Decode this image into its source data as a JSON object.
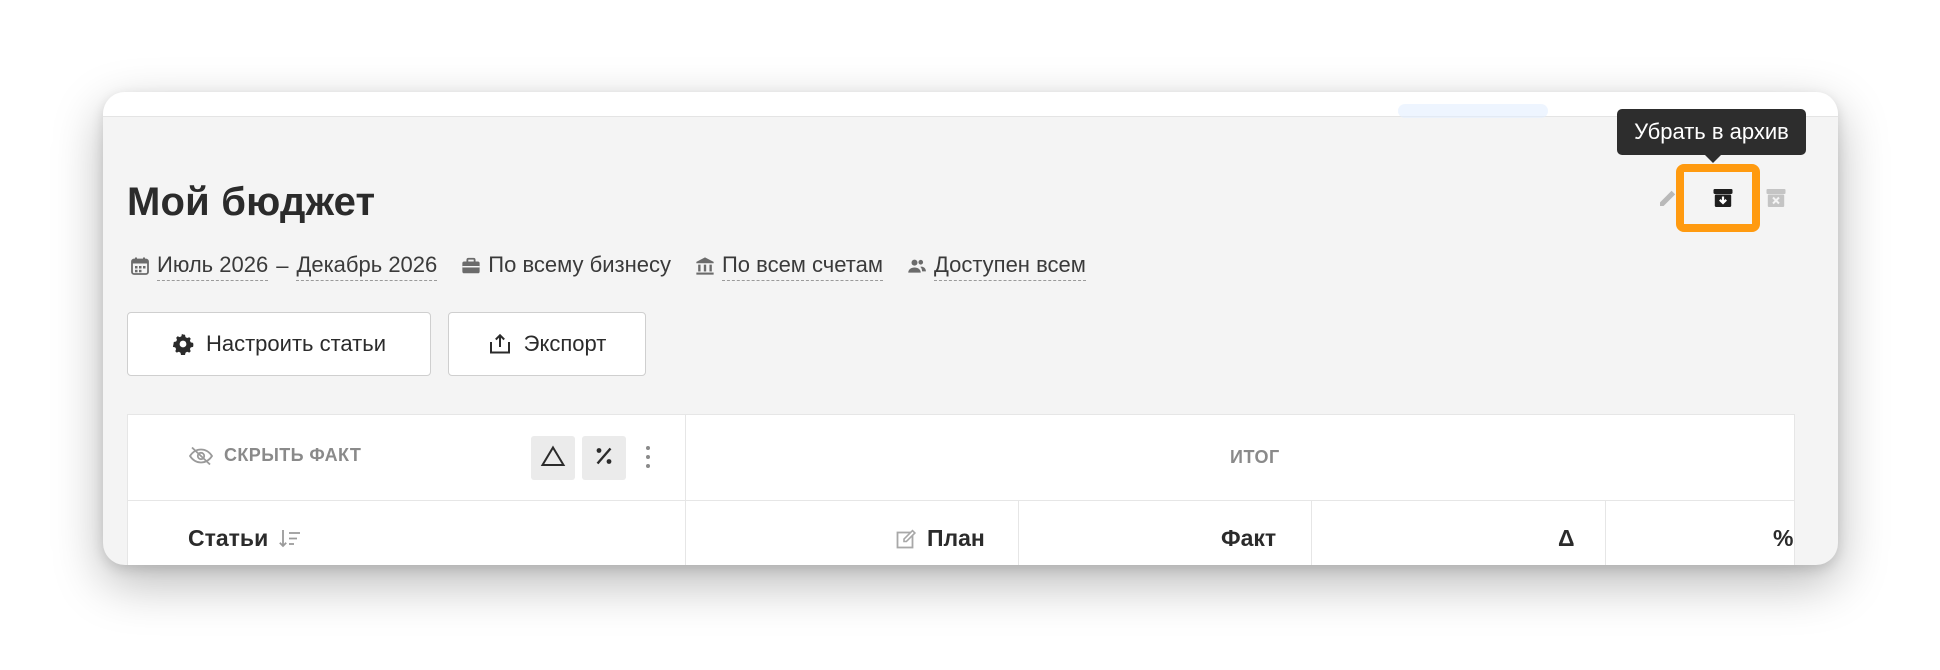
{
  "budget": {
    "title": "Мой бюджет",
    "period_start": "Июль 2026",
    "period_separator": "–",
    "period_end": "Декабрь 2026",
    "scope": "По всему бизнесу",
    "accounts": "По всем счетам",
    "access": "Доступен всем"
  },
  "actions": {
    "tooltip": "Убрать в архив",
    "edit_icon": "pencil-icon",
    "archive_icon": "archive-icon",
    "delete_icon": "trash-icon"
  },
  "toolbar": {
    "configure_label": "Настроить статьи",
    "export_label": "Экспорт"
  },
  "table": {
    "hide_fact_label": "СКРЫТЬ ФАКТ",
    "total_label": "ИТОГ",
    "columns": {
      "items": "Статьи",
      "plan": "План",
      "fact": "Факт",
      "delta": "Δ",
      "percent": "%"
    }
  },
  "colors": {
    "highlight": "#ff9a0f",
    "tooltip_bg": "#2d2d2d",
    "card_bg": "#f4f4f4"
  }
}
